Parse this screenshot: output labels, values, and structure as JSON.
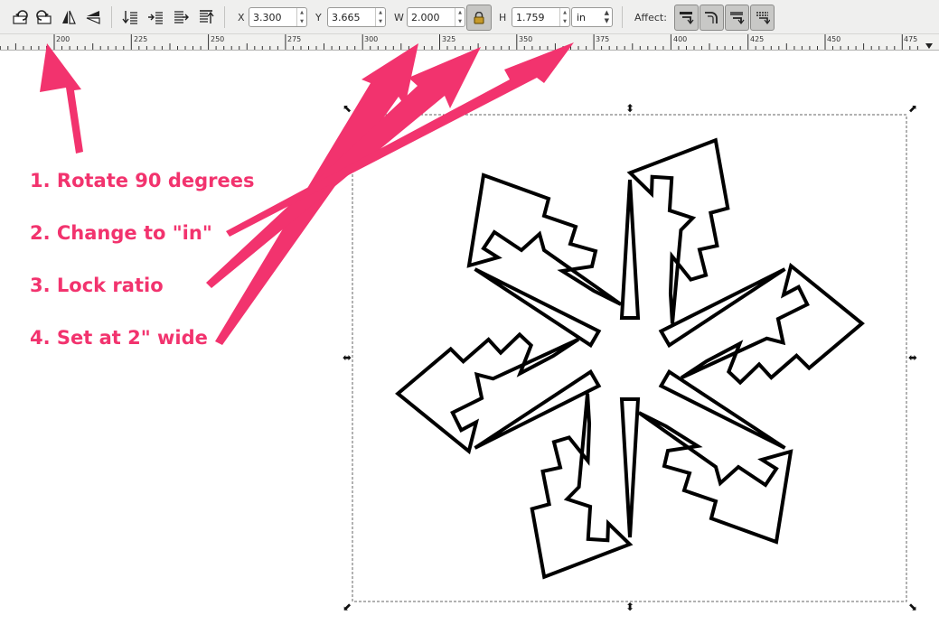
{
  "toolbar": {
    "rotate_ccw": {
      "icon": "rotate-ccw-icon"
    },
    "rotate_cw": {
      "icon": "rotate-cw-icon"
    },
    "flip_horizontal": {
      "icon": "flip-horizontal-icon"
    },
    "flip_vertical": {
      "icon": "flip-vertical-icon"
    },
    "raise_to_top": {
      "icon": "raise-to-top-icon"
    },
    "raise": {
      "icon": "raise-icon"
    },
    "lower": {
      "icon": "lower-icon"
    },
    "lower_to_bottom": {
      "icon": "lower-to-bottom-icon"
    },
    "x": {
      "label": "X",
      "value": "3.300"
    },
    "y": {
      "label": "Y",
      "value": "3.665"
    },
    "w": {
      "label": "W",
      "value": "2.000"
    },
    "lock": {
      "icon": "lock-icon",
      "locked": true
    },
    "h": {
      "label": "H",
      "value": "1.759"
    },
    "units": {
      "value": "in"
    },
    "affect": {
      "label": "Affect:",
      "buttons": [
        {
          "icon": "scale-stroke-icon"
        },
        {
          "icon": "scale-rounded-corners-icon"
        },
        {
          "icon": "move-gradients-icon"
        },
        {
          "icon": "move-patterns-icon"
        }
      ]
    }
  },
  "ruler": {
    "labels": [
      "200",
      "225",
      "250",
      "275",
      "300",
      "325",
      "350",
      "375",
      "400",
      "425",
      "450",
      "475"
    ]
  },
  "annotations": {
    "step1": "1. Rotate 90 degrees",
    "step2": "2. Change to \"in\"",
    "step3": "3. Lock ratio",
    "step4": "4. Set at 2\" wide",
    "arrow_color": "#f2336e"
  },
  "canvas": {
    "object": "snowflake"
  }
}
